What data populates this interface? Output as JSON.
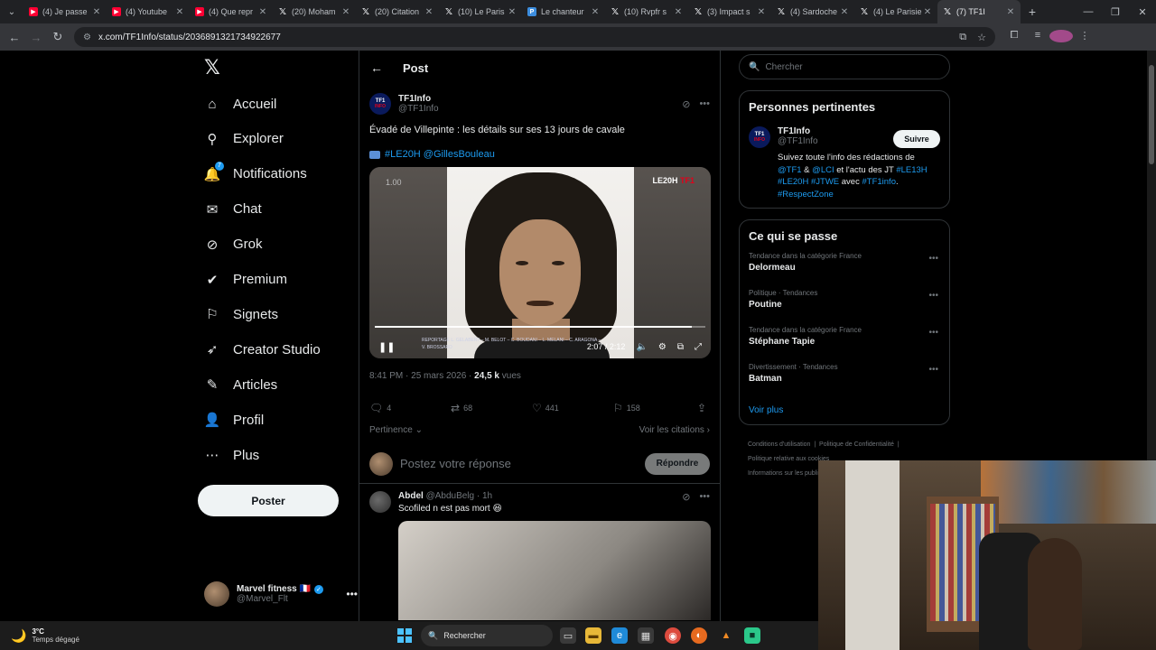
{
  "browser": {
    "tabs": [
      {
        "label": "(4) Je passe",
        "icon": "youtube-icon"
      },
      {
        "label": "(4) Youtube",
        "icon": "youtube-icon"
      },
      {
        "label": "(4) Que repr",
        "icon": "youtube-icon"
      },
      {
        "label": "(20) Moham",
        "icon": "x-icon"
      },
      {
        "label": "(20) Citation",
        "icon": "x-icon"
      },
      {
        "label": "(10) Le Paris",
        "icon": "x-icon"
      },
      {
        "label": "Le chanteur",
        "icon": "parisien-icon"
      },
      {
        "label": "(10) Rvpfr s",
        "icon": "x-icon"
      },
      {
        "label": "(3) Impact s",
        "icon": "x-icon"
      },
      {
        "label": "(4) Sardoche",
        "icon": "x-icon"
      },
      {
        "label": "(4) Le Parisie",
        "icon": "x-icon"
      },
      {
        "label": "(7) TF1I",
        "icon": "x-icon"
      }
    ],
    "url": "x.com/TF1Info/status/2036891321734922677"
  },
  "nav": {
    "items": [
      {
        "label": "Accueil",
        "icon": "home-icon"
      },
      {
        "label": "Explorer",
        "icon": "search-icon"
      },
      {
        "label": "Notifications",
        "icon": "bell-icon",
        "badge": "7"
      },
      {
        "label": "Chat",
        "icon": "mail-icon"
      },
      {
        "label": "Grok",
        "icon": "grok-icon"
      },
      {
        "label": "Premium",
        "icon": "verified-icon"
      },
      {
        "label": "Signets",
        "icon": "bookmark-icon"
      },
      {
        "label": "Creator Studio",
        "icon": "rocket-icon"
      },
      {
        "label": "Articles",
        "icon": "article-icon"
      },
      {
        "label": "Profil",
        "icon": "person-icon"
      },
      {
        "label": "Plus",
        "icon": "more-circle-icon"
      }
    ],
    "post_button": "Poster",
    "me": {
      "name": "Marvel fitness 🇫🇷",
      "handle": "@Marvel_Flt"
    }
  },
  "main": {
    "header_title": "Post",
    "tweet": {
      "author_name": "TF1Info",
      "author_handle": "@TF1Info",
      "logo_line1": "TF1",
      "logo_line2": "INFO",
      "text": "Évadé de Villepinte : les détails sur ses 13 jours de cavale",
      "tags": "#LE20H @GillesBouleau",
      "video": {
        "speed": "1.00",
        "brand": "LE20H",
        "brand_suffix": "TF1",
        "credits": "REPORTAGE L. GELABERT – M. BELOT – C. BOUDANI – L. MELANI – C. ARAGONA – V. BROSSARD",
        "time": "2:07 / 2:12",
        "progress": 0.96
      },
      "timestamp": "8:41 PM · 25 mars 2026 · ",
      "views_count": "24,5 k",
      "views_label": " vues",
      "stats": {
        "replies": "4",
        "reposts": "68",
        "likes": "441",
        "bookmarks": "158"
      }
    },
    "sort_label": "Pertinence ⌄",
    "citations_label": "Voir les citations ›",
    "reply_placeholder": "Postez votre réponse",
    "reply_button": "Répondre",
    "reply": {
      "name": "Abdel",
      "handle": "@AbduBelg · 1h",
      "text": "Scofiled n est pas mort 😆"
    }
  },
  "right": {
    "search_placeholder": "Chercher",
    "relevant_title": "Personnes pertinentes",
    "person": {
      "name": "TF1Info",
      "handle": "@TF1Info",
      "follow": "Suivre",
      "bio_1": "Suivez toute l'info des rédactions de ",
      "bio_tf1": "@TF1",
      "bio_2": " & ",
      "bio_lci": "@LCI",
      "bio_3": " et l'actu des JT ",
      "bio_le13h": "#LE13H",
      "bio_le20h": "#LE20H",
      "bio_jtwe": "#JTWE",
      "bio_4": " avec ",
      "bio_tf1info": "#TF1info",
      "bio_5": ".",
      "bio_respect": "#RespectZone"
    },
    "trends_title": "Ce qui se passe",
    "trends": [
      {
        "context": "Tendance dans la catégorie France",
        "name": "Delormeau"
      },
      {
        "context": "Politique · Tendances",
        "name": "Poutine"
      },
      {
        "context": "Tendance dans la catégorie France",
        "name": "Stéphane Tapie"
      },
      {
        "context": "Divertissement · Tendances",
        "name": "Batman"
      }
    ],
    "see_more": "Voir plus",
    "footer_1": "Conditions d'utilisation",
    "footer_2": "Politique de Confidentialité",
    "footer_3": "Politique relative aux cookies",
    "footer_4": "Informations sur les publicités"
  },
  "taskbar": {
    "temperature": "3°C",
    "weather": "Temps dégagé",
    "search": "Rechercher"
  }
}
